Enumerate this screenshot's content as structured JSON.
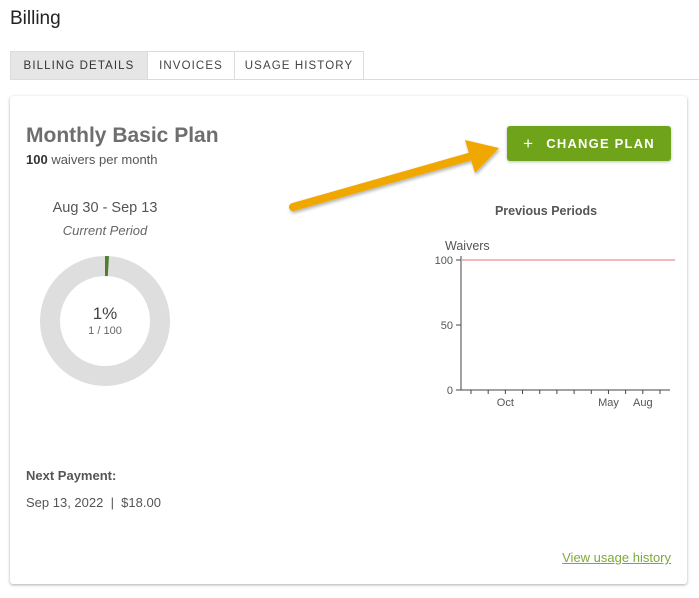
{
  "page": {
    "title": "Billing"
  },
  "tabs": [
    {
      "label": "BILLING DETAILS",
      "active": true
    },
    {
      "label": "INVOICES",
      "active": false
    },
    {
      "label": "USAGE HISTORY",
      "active": false
    }
  ],
  "plan": {
    "name": "Monthly Basic Plan",
    "waiver_count": "100",
    "waiver_suffix": " waivers per month",
    "change_label": "CHANGE PLAN",
    "change_icon": "plus-icon"
  },
  "current_period": {
    "range": "Aug 30 - Sep 13",
    "label": "Current Period",
    "percent_text": "1%",
    "usage_text": "1 / 100",
    "used": 1,
    "limit": 100
  },
  "next_payment": {
    "label": "Next Payment:",
    "value": "Sep 13, 2022  |  $18.00"
  },
  "links": {
    "view_usage_history": "View usage history"
  },
  "colors": {
    "accent": "#6ea31a",
    "donut_track": "#dedede",
    "donut_fill": "#4f7f2b",
    "limit_line": "#e8a3a3",
    "arrow": "#f0a800"
  },
  "chart_data": {
    "type": "line",
    "title": "Previous Periods",
    "ylabel": "Waivers",
    "ylim": [
      0,
      100
    ],
    "yticks": [
      0,
      50,
      100
    ],
    "x_tick_labels": [
      "Oct",
      "May",
      "Aug"
    ],
    "series": [
      {
        "values": [
          100,
          100
        ]
      }
    ]
  }
}
